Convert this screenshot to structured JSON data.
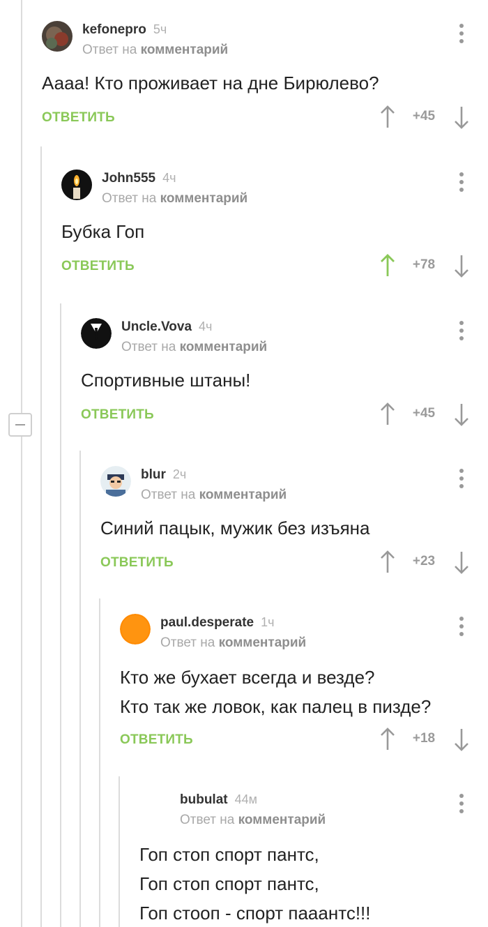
{
  "comments": [
    {
      "author": "kefonepro",
      "time": "5ч",
      "reply_prefix": "Ответ на",
      "reply_target": "комментарий",
      "text_lines": [
        "Аааа! Кто проживает на дне Бирюлево?"
      ],
      "reply_label": "ОТВЕТИТЬ",
      "score": "+45",
      "upvoted": false
    },
    {
      "author": "John555",
      "time": "4ч",
      "reply_prefix": "Ответ на",
      "reply_target": "комментарий",
      "text_lines": [
        "Бубка Гоп"
      ],
      "reply_label": "ОТВЕТИТЬ",
      "score": "+78",
      "upvoted": true
    },
    {
      "author": "Uncle.Vova",
      "time": "4ч",
      "reply_prefix": "Ответ на",
      "reply_target": "комментарий",
      "text_lines": [
        "Спортивные штаны!"
      ],
      "reply_label": "ОТВЕТИТЬ",
      "score": "+45",
      "upvoted": false
    },
    {
      "author": "blur",
      "time": "2ч",
      "reply_prefix": "Ответ на",
      "reply_target": "комментарий",
      "text_lines": [
        "Синий пацык, мужик без изъяна"
      ],
      "reply_label": "ОТВЕТИТЬ",
      "score": "+23",
      "upvoted": false
    },
    {
      "author": "paul.desperate",
      "time": "1ч",
      "reply_prefix": "Ответ на",
      "reply_target": "комментарий",
      "text_lines": [
        "Кто же бухает всегда и везде?",
        "Кто так же ловок, как палец в пизде?"
      ],
      "reply_label": "ОТВЕТИТЬ",
      "score": "+18",
      "upvoted": false
    },
    {
      "author": "bubulat",
      "time": "44м",
      "reply_prefix": "Ответ на",
      "reply_target": "комментарий",
      "text_lines": [
        "Гоп стоп спорт пантс,",
        "Гоп стоп спорт пантс,",
        "Гоп стооп - спорт пааантс!!!"
      ]
    }
  ],
  "colors": {
    "accent_green": "#8ac858",
    "muted_gray": "#9a9a9a"
  }
}
